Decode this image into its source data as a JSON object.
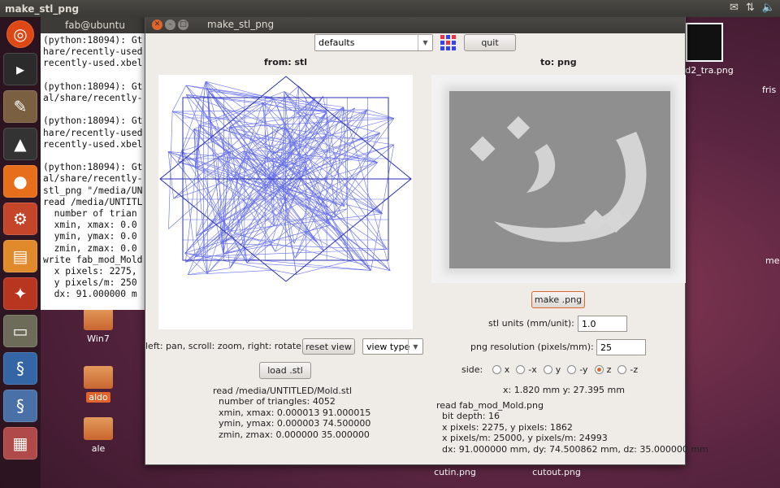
{
  "topbar": {
    "title": "make_stl_png"
  },
  "terminal": {
    "title": "fab@ubuntu",
    "lines": [
      "(python:18094): Gt",
      "hare/recently-used",
      "recently-used.xbel",
      "",
      "(python:18094): Gt",
      "al/share/recently-",
      "",
      "(python:18094): Gt",
      "hare/recently-used",
      "recently-used.xbel",
      "",
      "(python:18094): Gt",
      "al/share/recently-",
      "stl_png \"/media/UN",
      "read /media/UNTITL",
      "  number of trian",
      "  xmin, xmax: 0.0",
      "  ymin, ymax: 0.0",
      "  zmin, zmax: 0.0",
      "write fab_mod_Mold",
      "  x pixels: 2275,",
      "  y pixels/m: 250",
      "  dx: 91.000000 m"
    ]
  },
  "desktop_icons": {
    "win7": "Win7",
    "aldo": "aldo",
    "ale": "ale",
    "d2_tra": "d2_tra.png",
    "cutin": "cutin.png",
    "cutout": "cutout.png",
    "fris": "fris",
    "me": "me"
  },
  "window": {
    "title": "make_stl_png",
    "defaults_combo": "defaults",
    "quit_label": "quit",
    "from_label": "from: stl",
    "to_label": "to: png",
    "hint_text": "left: pan, scroll: zoom, right: rotate",
    "reset_view_label": "reset view",
    "view_type_combo": "view type",
    "load_stl_label": "load .stl",
    "make_png_label": "make .png",
    "stl_units_label": "stl units (mm/unit):",
    "stl_units_value": "1.0",
    "png_res_label": "png resolution (pixels/mm):",
    "png_res_value": "25",
    "side_label": "side:",
    "side_options": [
      "x",
      "-x",
      "y",
      "-y",
      "z",
      "-z"
    ],
    "side_selected": "z",
    "coord_readout": "x: 1.820 mm  y: 27.395 mm",
    "stl_info": "read /media/UNTITLED/Mold.stl\n  number of triangles: 4052\n  xmin, xmax: 0.000013 91.000015\n  ymin, ymax: 0.000003 74.500000\n  zmin, zmax: 0.000000 35.000000",
    "png_info": "read fab_mod_Mold.png\n  bit depth: 16\n  x pixels: 2275, y pixels: 1862\n  x pixels/m: 25000, y pixels/m: 24993\n  dx: 91.000000 mm, dy: 74.500862 mm, dz: 35.000000 mm"
  },
  "colors": {
    "mesh": "#4a55e6",
    "accent": "#e0642c"
  }
}
